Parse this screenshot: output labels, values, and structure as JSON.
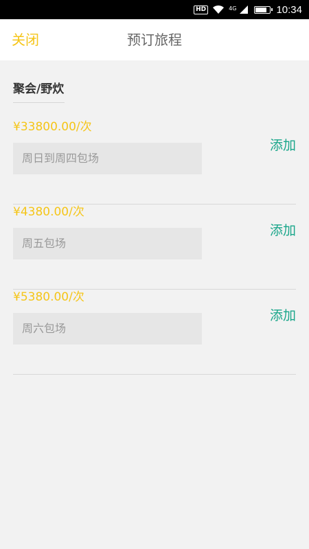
{
  "status_bar": {
    "hd_label": "HD",
    "network_label": "4G",
    "time": "10:34"
  },
  "header": {
    "close_label": "关闭",
    "title": "预订旅程"
  },
  "section": {
    "title": "聚会/野炊"
  },
  "items": [
    {
      "price": "¥33800.00/次",
      "description": "周日到周四包场",
      "add_label": "添加"
    },
    {
      "price": "¥4380.00/次",
      "description": "周五包场",
      "add_label": "添加"
    },
    {
      "price": "¥5380.00/次",
      "description": "周六包场",
      "add_label": "添加"
    }
  ],
  "colors": {
    "accent_yellow": "#f5c518",
    "add_green": "#1aa68a",
    "background": "#f2f2f2"
  }
}
